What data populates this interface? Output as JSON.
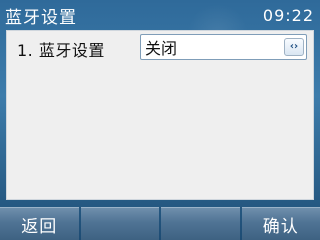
{
  "header": {
    "title": "蓝牙设置",
    "time": "09:22"
  },
  "settings": {
    "items": [
      {
        "index": "1.",
        "label": "1. 蓝牙设置",
        "value": "关闭",
        "switch_icon": "left-right-arrows-icon"
      }
    ]
  },
  "softkeys": [
    {
      "label": "返回"
    },
    {
      "label": ""
    },
    {
      "label": ""
    },
    {
      "label": "确认"
    }
  ],
  "colors": {
    "background": "#3d7cab",
    "panel": "#efefef",
    "softkey": "#4f7394"
  }
}
